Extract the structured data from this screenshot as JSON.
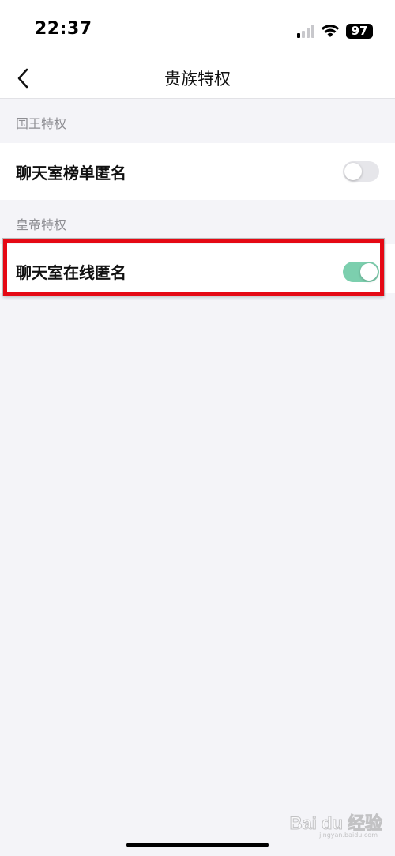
{
  "status_bar": {
    "time": "22:37",
    "battery": "97",
    "icons": [
      "cellular-signal-icon",
      "wifi-icon",
      "battery-icon"
    ]
  },
  "nav": {
    "title": "贵族特权",
    "back_icon": "chevron-left-icon"
  },
  "sections": [
    {
      "header": "国王特权",
      "item": {
        "label": "聊天室榜单匿名",
        "enabled": false
      }
    },
    {
      "header": "皇帝特权",
      "item": {
        "label": "聊天室在线匿名",
        "enabled": true
      }
    }
  ],
  "colors": {
    "toggle_on": "#7ccfae",
    "toggle_off": "#e6e6ea",
    "highlight": "#e50914",
    "background": "#f4f4f8"
  },
  "watermark": {
    "logo": "Bai du 经验",
    "sub": "jingyan.baidu.com"
  }
}
